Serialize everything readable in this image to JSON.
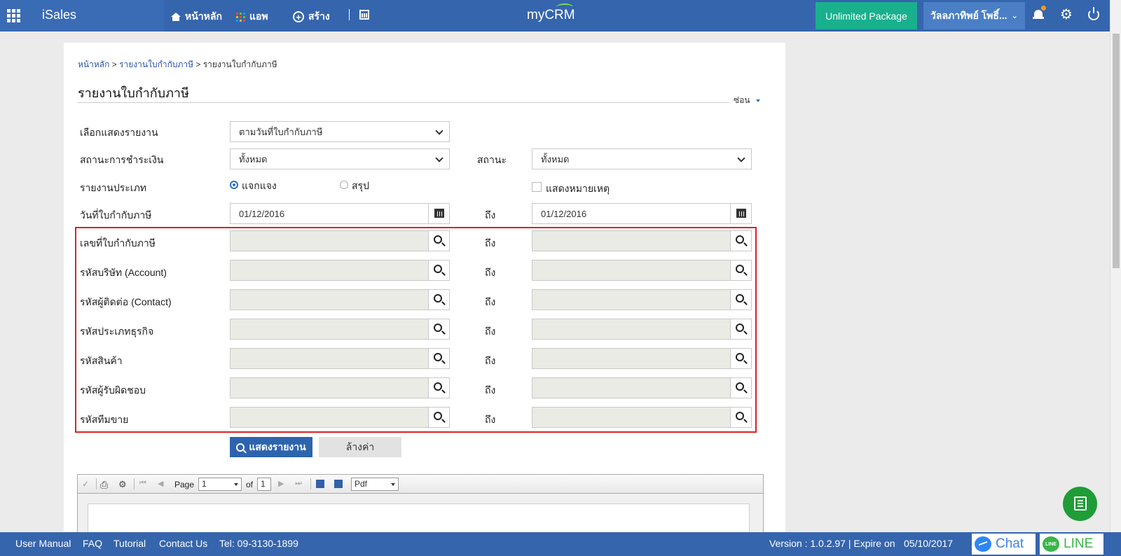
{
  "topbar": {
    "app_name": "iSales",
    "nav_home": "หน้าหลัก",
    "nav_app": "แอพ",
    "nav_create": "สร้าง",
    "logo": "myCRM",
    "package": "Unlimited Package",
    "user": "วัลลภาทิพย์ โพธิ์...",
    "colors": {
      "bar": "#3565ad",
      "package": "#19b08d",
      "user": "#4a7fc6"
    }
  },
  "breadcrumb": {
    "home": "หน้าหลัก",
    "parent": "รายงานใบกำกับภาษี",
    "current": "รายงานใบกำกับภาษี",
    "sep": ">"
  },
  "page": {
    "title": "รายงานใบกำกับภาษี",
    "hide_label": "ซ่อน"
  },
  "form": {
    "report_display": {
      "label": "เลือกแสดงรายงาน",
      "value": "ตามวันที่ใบกำกับภาษี"
    },
    "payment_status": {
      "label": "สถานะการชำระเงิน",
      "value": "ทั้งหมด"
    },
    "status": {
      "label": "สถานะ",
      "value": "ทั้งหมด"
    },
    "report_type": {
      "label": "รายงานประเภท",
      "option_detail": "แจกแจง",
      "option_summary": "สรุป",
      "selected": "แจกแจง"
    },
    "show_note": {
      "label": "แสดงหมายเหตุ",
      "checked": false
    },
    "invoice_date": {
      "label": "วันที่ใบกำกับภาษี",
      "from": "01/12/2016",
      "to": "01/12/2016"
    },
    "to_label": "ถึง",
    "range_fields": [
      {
        "label": "เลขที่ใบกำกับภาษี",
        "from": "",
        "to": ""
      },
      {
        "label": "รหัสบริษัท (Account)",
        "from": "",
        "to": ""
      },
      {
        "label": "รหัสผู้ติดต่อ (Contact)",
        "from": "",
        "to": ""
      },
      {
        "label": "รหัสประเภทธุรกิจ",
        "from": "",
        "to": ""
      },
      {
        "label": "รหัสสินค้า",
        "from": "",
        "to": ""
      },
      {
        "label": "รหัสผู้รับผิดชอบ",
        "from": "",
        "to": ""
      },
      {
        "label": "รหัสทีมขาย",
        "from": "",
        "to": ""
      }
    ],
    "show_button": "แสดงรายงาน",
    "clear_button": "ล้างค่า"
  },
  "report_toolbar": {
    "page_label": "Page",
    "page_value": "1",
    "of_label": "of",
    "total_pages": "1",
    "format": "Pdf"
  },
  "footer": {
    "links": [
      "User Manual",
      "FAQ",
      "Tutorial",
      "Contact Us"
    ],
    "tel": "Tel: 09-3130-1899",
    "version": "Version : 1.0.2.97 | Expire on",
    "expire_date": "05/10/2017",
    "chat": "Chat",
    "line": "LINE"
  }
}
